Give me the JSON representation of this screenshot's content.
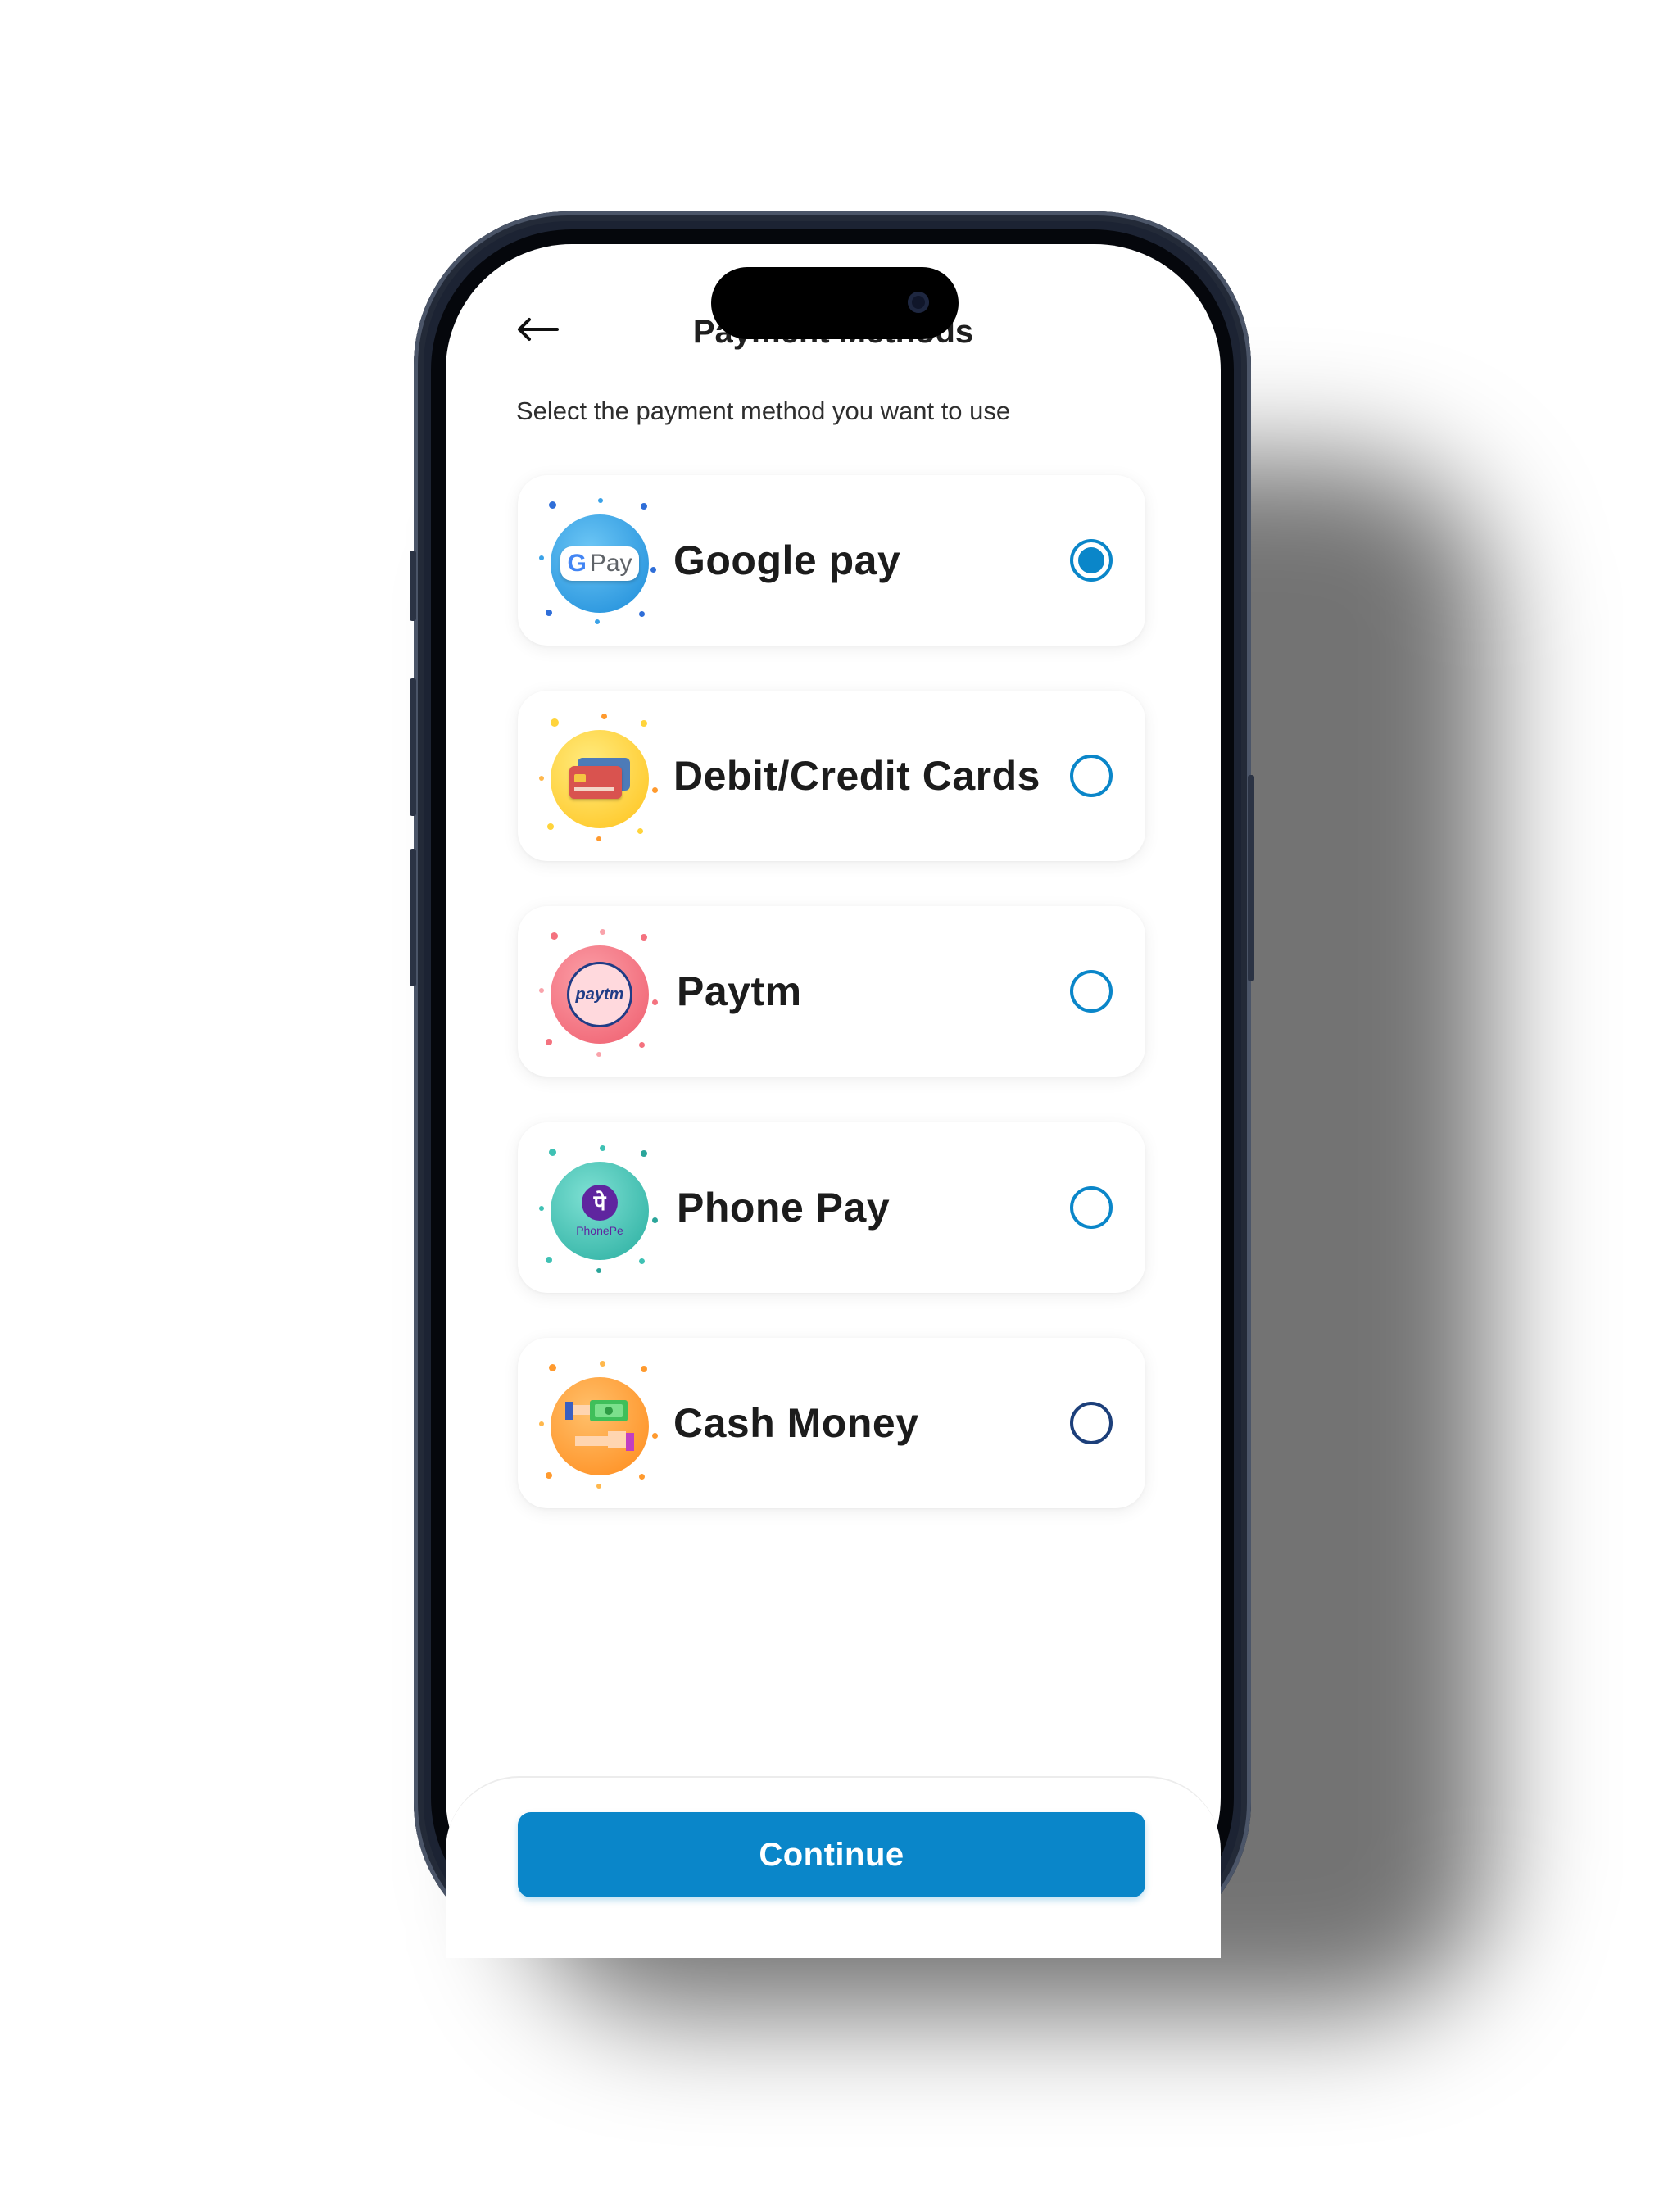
{
  "header": {
    "title": "Payment Methods",
    "back_icon": "arrow-left-icon"
  },
  "subtitle": "Select the payment method you want to use",
  "methods": [
    {
      "label": "Google pay",
      "logo_text": "G Pay",
      "icon": "google-pay-icon",
      "selected": true
    },
    {
      "label": "Debit/Credit Cards",
      "icon": "credit-cards-icon",
      "selected": false
    },
    {
      "label": "Paytm",
      "logo_text": "paytm",
      "icon": "paytm-icon",
      "selected": false
    },
    {
      "label": "Phone Pay",
      "logo_text": "PhonePe",
      "logo_glyph": "पे",
      "icon": "phonepe-icon",
      "selected": false
    },
    {
      "label": "Cash Money",
      "icon": "cash-hands-icon",
      "selected": false
    }
  ],
  "continue_label": "Continue",
  "colors": {
    "accent": "#0a86c9",
    "gpay_bg": "#2aa3e8",
    "cards_bg": "#ffd43b",
    "paytm_bg": "#f4727f",
    "phonepe_bg": "#3fc1b4",
    "cash_bg": "#ff9a2e"
  }
}
